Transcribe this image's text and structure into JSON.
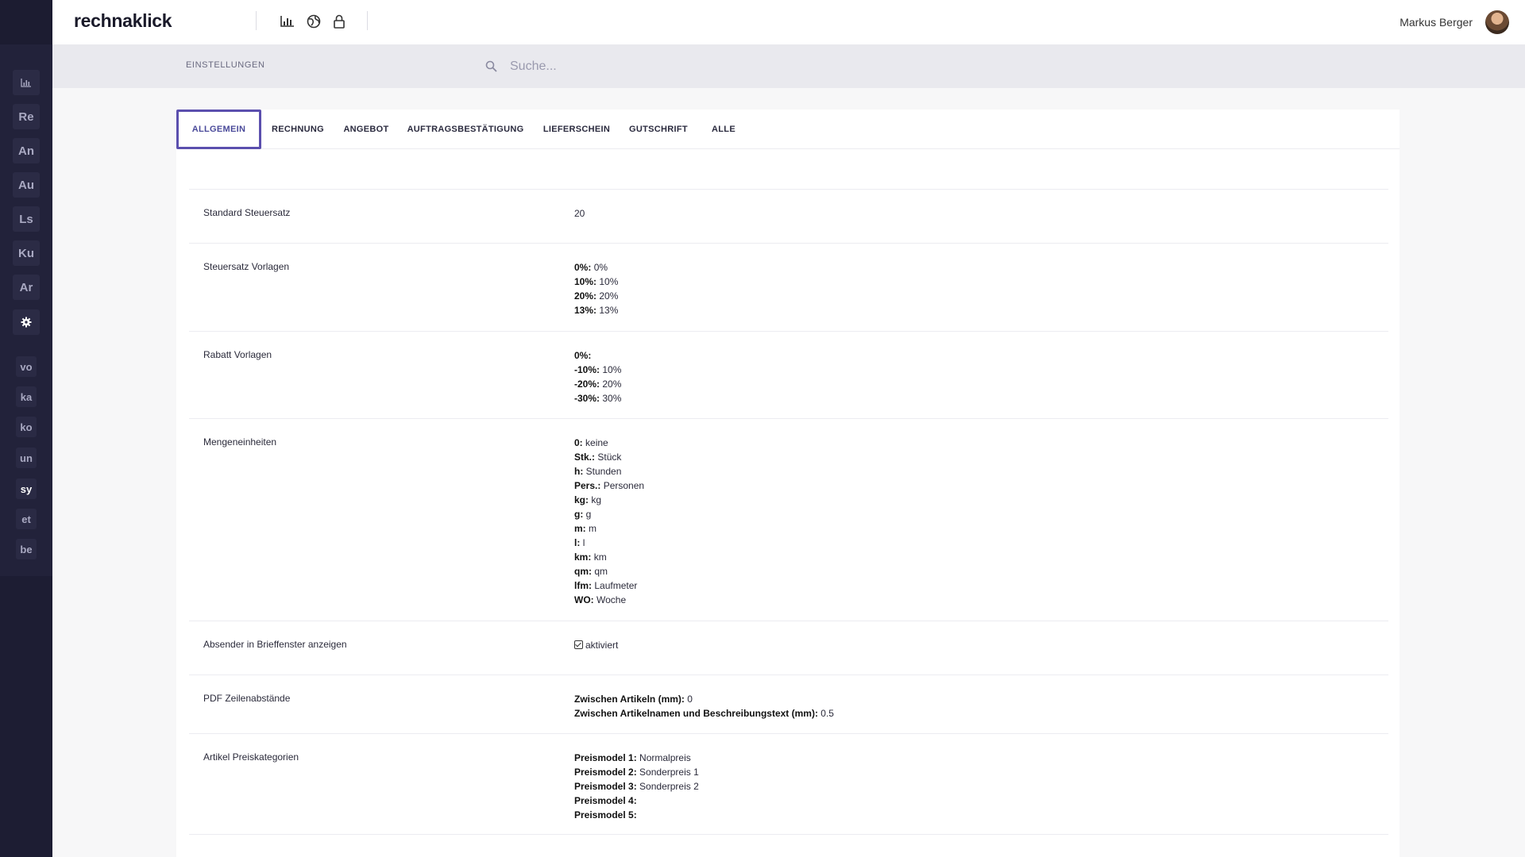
{
  "app": {
    "brand": "rechnaklick",
    "user_name": "Markus Berger"
  },
  "sidebar": {
    "main_items": [
      {
        "label": "",
        "icon": "chart-icon"
      },
      {
        "label": "Re"
      },
      {
        "label": "An"
      },
      {
        "label": "Au"
      },
      {
        "label": "Ls"
      },
      {
        "label": "Ku"
      },
      {
        "label": "Ar"
      },
      {
        "label": "",
        "icon": "gear-icon"
      }
    ],
    "sub_items": [
      "vo",
      "ka",
      "ko",
      "un",
      "sy",
      "et",
      "be"
    ]
  },
  "subheader": {
    "title": "EINSTELLUNGEN",
    "search_placeholder": "Suche..."
  },
  "tabs": [
    {
      "label": "ALLGEMEIN"
    },
    {
      "label": "RECHNUNG"
    },
    {
      "label": "ANGEBOT"
    },
    {
      "label": "AUFTRAGSBESTÄTIGUNG"
    },
    {
      "label": "LIEFERSCHEIN"
    },
    {
      "label": "GUTSCHRIFT"
    },
    {
      "label": "ALLE"
    }
  ],
  "settings": {
    "standard_tax": {
      "label": "Standard Steuersatz",
      "value": "20"
    },
    "tax_templates": {
      "label": "Steuersatz Vorlagen",
      "items": [
        {
          "key": "0%:",
          "value": "0%"
        },
        {
          "key": "10%:",
          "value": "10%"
        },
        {
          "key": "20%:",
          "value": "20%"
        },
        {
          "key": "13%:",
          "value": "13%"
        }
      ]
    },
    "discount_templates": {
      "label": "Rabatt Vorlagen",
      "items": [
        {
          "key": "0%:",
          "value": ""
        },
        {
          "key": "-10%:",
          "value": "10%"
        },
        {
          "key": "-20%:",
          "value": "20%"
        },
        {
          "key": "-30%:",
          "value": "30%"
        }
      ]
    },
    "units": {
      "label": "Mengeneinheiten",
      "items": [
        {
          "key": "0:",
          "value": "keine"
        },
        {
          "key": "Stk.:",
          "value": "Stück"
        },
        {
          "key": "h:",
          "value": "Stunden"
        },
        {
          "key": "Pers.:",
          "value": "Personen"
        },
        {
          "key": "kg:",
          "value": "kg"
        },
        {
          "key": "g:",
          "value": "g"
        },
        {
          "key": "m:",
          "value": "m"
        },
        {
          "key": "l:",
          "value": "l"
        },
        {
          "key": "km:",
          "value": "km"
        },
        {
          "key": "qm:",
          "value": "qm"
        },
        {
          "key": "lfm:",
          "value": "Laufmeter"
        },
        {
          "key": "WO:",
          "value": "Woche"
        }
      ]
    },
    "sender_window": {
      "label": "Absender in Brieffenster anzeigen",
      "value": "aktiviert"
    },
    "pdf_spacing": {
      "label": "PDF Zeilenabstände",
      "items": [
        {
          "key": "Zwischen Artikeln (mm):",
          "value": "0"
        },
        {
          "key": "Zwischen Artikelnamen und Beschreibungstext (mm):",
          "value": "0.5"
        }
      ]
    },
    "price_categories": {
      "label": "Artikel Preiskategorien",
      "items": [
        {
          "key": "Preismodel 1:",
          "value": "Normalpreis"
        },
        {
          "key": "Preismodel 2:",
          "value": "Sonderpreis 1"
        },
        {
          "key": "Preismodel 3:",
          "value": "Sonderpreis 2"
        },
        {
          "key": "Preismodel 4:",
          "value": ""
        },
        {
          "key": "Preismodel 5:",
          "value": ""
        }
      ]
    }
  },
  "colors": {
    "sidebar": "#22223a",
    "accent": "#5b4fae",
    "subbar": "#e9e9ee"
  }
}
